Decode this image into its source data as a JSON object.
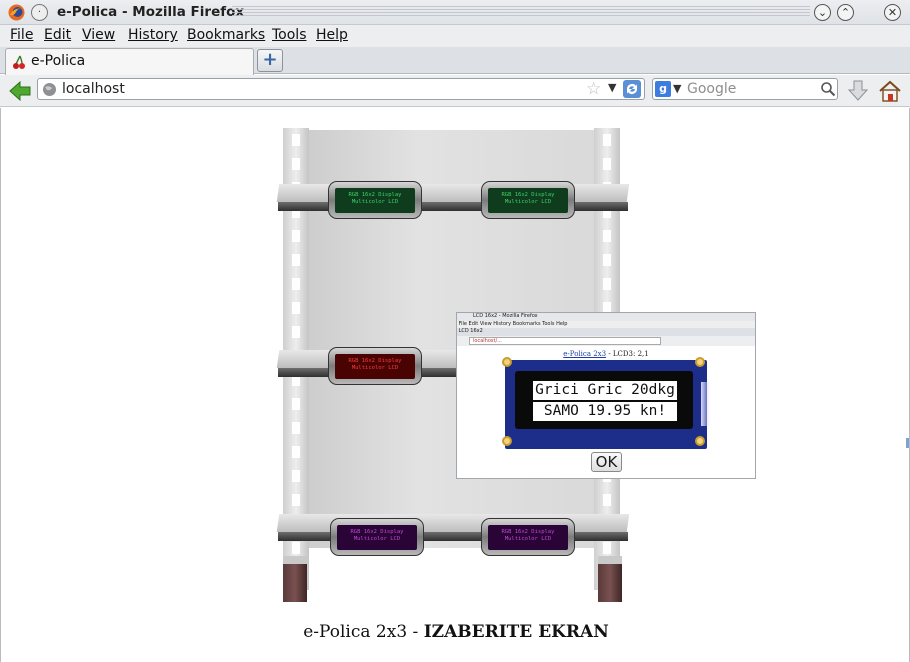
{
  "window": {
    "title": "e-Polica - Mozilla Firefox"
  },
  "menubar": {
    "items": [
      {
        "label": "File"
      },
      {
        "label": "Edit"
      },
      {
        "label": "View"
      },
      {
        "label": "History"
      },
      {
        "label": "Bookmarks"
      },
      {
        "label": "Tools"
      },
      {
        "label": "Help"
      }
    ]
  },
  "tabs": [
    {
      "label": "e-Polica",
      "active": true
    }
  ],
  "navbar": {
    "url": "localhost",
    "search_placeholder": "Google",
    "search_engine_icon": "google-icon"
  },
  "shelf": {
    "lcd_text_line1": "RGB 16x2 Display",
    "lcd_text_line2": "Multicolor LCD",
    "row_colors": {
      "top": "#3ed26b",
      "middle": "#ff3a3a",
      "bottom": "#c24ad4"
    }
  },
  "popup": {
    "window_title": "LCD 16x2 - Mozilla Firefox",
    "tab_label": "LCD 16x2",
    "url": "localhost/...",
    "heading_link": "e-Polica 2x3",
    "heading_rest": " - LCD3: 2,1",
    "lcd_line1": "Grici Gric 20dkg",
    "lcd_line2": "SAMO 19.95 kn!",
    "ok_label": "OK"
  },
  "caption": {
    "prefix": "e-Polica 2x3 - ",
    "bold": "IZABERITE EKRAN"
  }
}
